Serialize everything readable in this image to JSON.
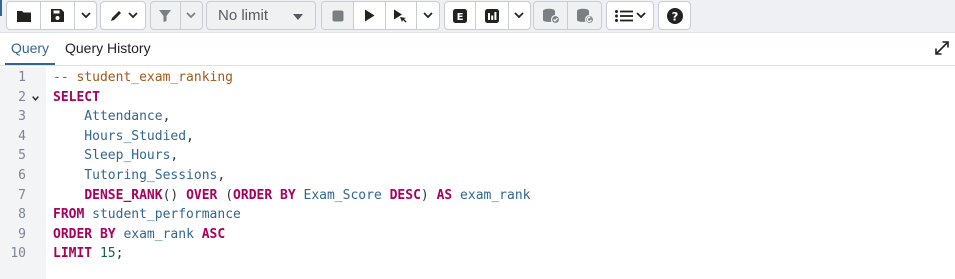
{
  "toolbar": {
    "buttons": [
      {
        "icon": "folder-open-icon",
        "label": "Open File"
      },
      {
        "icon": "save-icon",
        "label": "Save File"
      },
      {
        "icon": "save-dropdown-icon",
        "label": "Save options"
      },
      {
        "icon": "edit-icon",
        "label": "Edit"
      },
      {
        "icon": "filter-icon",
        "label": "Filter"
      },
      {
        "icon": "filter-dropdown-icon",
        "label": "Filter options"
      },
      {
        "icon": "stop-icon",
        "label": "Stop"
      },
      {
        "icon": "play-icon",
        "label": "Execute"
      },
      {
        "icon": "execute-options-icon",
        "label": "Execute options"
      },
      {
        "icon": "explain-icon",
        "label": "E"
      },
      {
        "icon": "explain-analyze-icon",
        "label": "Explain analyze"
      },
      {
        "icon": "commit-icon",
        "label": "Commit"
      },
      {
        "icon": "rollback-icon",
        "label": "Rollback"
      },
      {
        "icon": "macros-icon",
        "label": "Macros"
      },
      {
        "icon": "help-icon",
        "label": "?"
      }
    ],
    "limit": "No limit"
  },
  "tabs": {
    "items": [
      {
        "label": "Query",
        "active": true
      },
      {
        "label": "Query History",
        "active": false
      }
    ]
  },
  "editor": {
    "line_numbers": [
      "1",
      "2",
      "3",
      "4",
      "5",
      "6",
      "7",
      "8",
      "9",
      "10"
    ],
    "lines": [
      {
        "tokens": [
          {
            "t": "-- student_exam_ranking",
            "k": "cm"
          }
        ]
      },
      {
        "tokens": [
          {
            "t": "SELECT",
            "k": "kw"
          }
        ]
      },
      {
        "tokens": [
          {
            "t": "    Attendance",
            "k": "id"
          },
          {
            "t": ",",
            "k": "pl"
          }
        ]
      },
      {
        "tokens": [
          {
            "t": "    Hours_Studied",
            "k": "id"
          },
          {
            "t": ",",
            "k": "pl"
          }
        ]
      },
      {
        "tokens": [
          {
            "t": "    Sleep_Hours",
            "k": "id"
          },
          {
            "t": ",",
            "k": "pl"
          }
        ]
      },
      {
        "tokens": [
          {
            "t": "    Tutoring_Sessions",
            "k": "id"
          },
          {
            "t": ",",
            "k": "pl"
          }
        ]
      },
      {
        "tokens": [
          {
            "t": "    ",
            "k": "pl"
          },
          {
            "t": "DENSE_RANK",
            "k": "kw"
          },
          {
            "t": "() ",
            "k": "pl"
          },
          {
            "t": "OVER",
            "k": "kw"
          },
          {
            "t": " (",
            "k": "pl"
          },
          {
            "t": "ORDER BY",
            "k": "kw"
          },
          {
            "t": " Exam_Score ",
            "k": "id"
          },
          {
            "t": "DESC",
            "k": "kw"
          },
          {
            "t": ") ",
            "k": "pl"
          },
          {
            "t": "AS",
            "k": "kw"
          },
          {
            "t": " exam_rank",
            "k": "id"
          }
        ]
      },
      {
        "tokens": [
          {
            "t": "FROM",
            "k": "kw"
          },
          {
            "t": " student_performance",
            "k": "id"
          }
        ]
      },
      {
        "tokens": [
          {
            "t": "ORDER BY",
            "k": "kw"
          },
          {
            "t": " exam_rank ",
            "k": "id"
          },
          {
            "t": "ASC",
            "k": "kw"
          }
        ]
      },
      {
        "tokens": [
          {
            "t": "LIMIT",
            "k": "kw"
          },
          {
            "t": " ",
            "k": "pl"
          },
          {
            "t": "15",
            "k": "num"
          },
          {
            "t": ";",
            "k": "pl"
          }
        ]
      }
    ]
  },
  "colors": {
    "accent": "#326690",
    "keyword": "#a8005e",
    "comment": "#a05a1a",
    "number": "#116644"
  }
}
